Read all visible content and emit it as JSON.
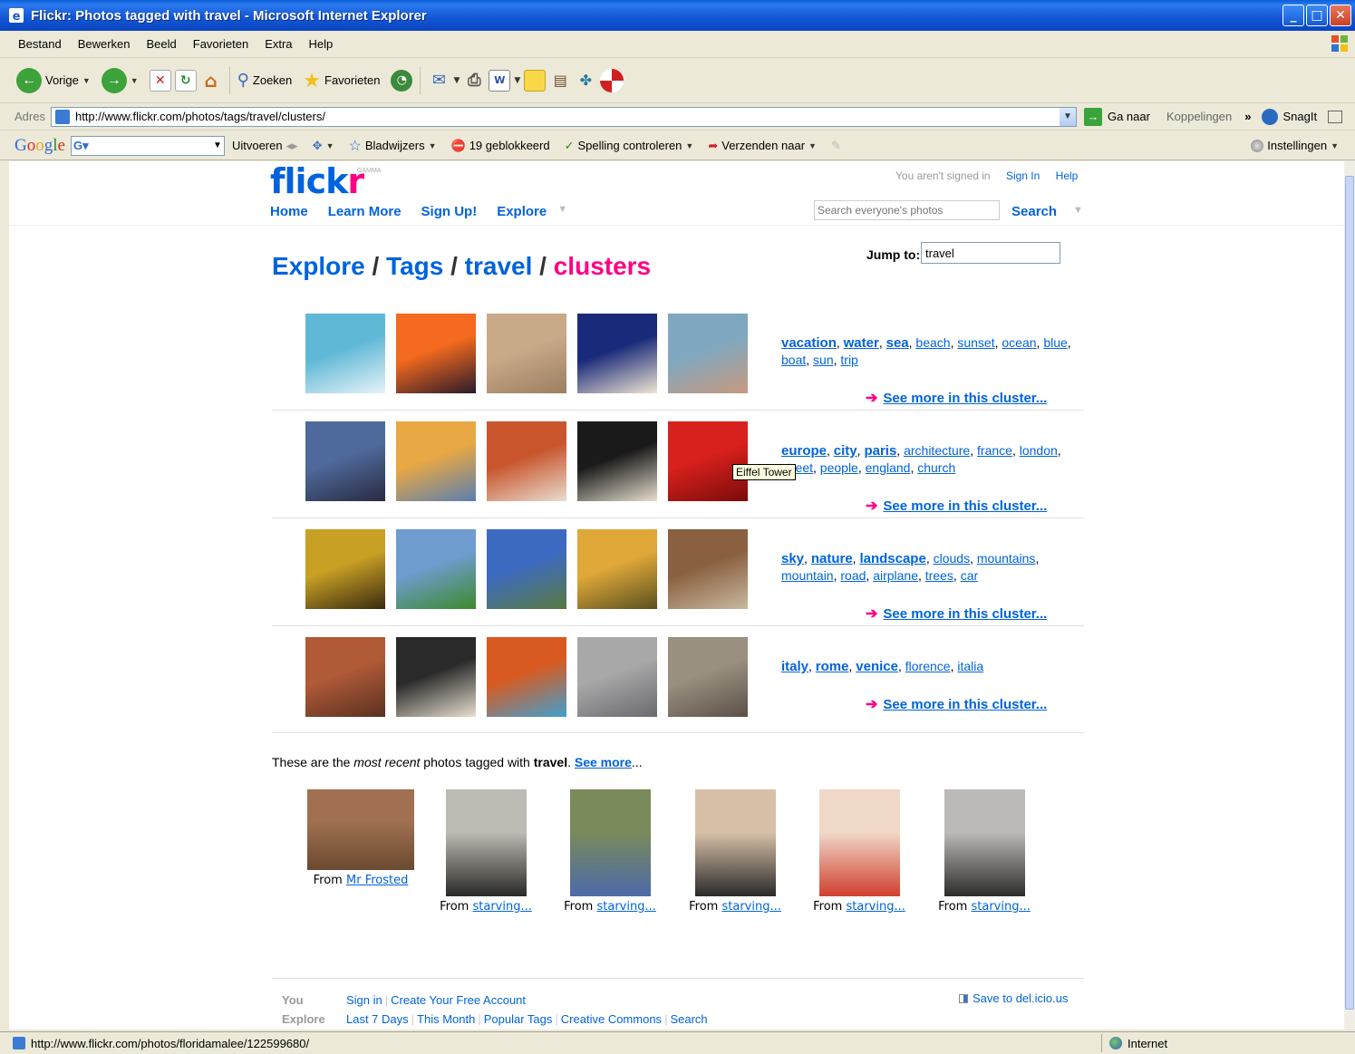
{
  "window": {
    "title": "Flickr: Photos tagged with travel - Microsoft Internet Explorer"
  },
  "menu": [
    "Bestand",
    "Bewerken",
    "Beeld",
    "Favorieten",
    "Extra",
    "Help"
  ],
  "toolbar": {
    "back": "Vorige",
    "search": "Zoeken",
    "favorites": "Favorieten"
  },
  "address": {
    "label": "Adres",
    "url": "http://www.flickr.com/photos/tags/travel/clusters/",
    "go": "Ga naar",
    "links": "Koppelingen",
    "snagit": "SnagIt"
  },
  "google": {
    "run": "Uitvoeren",
    "bookmarks": "Bladwijzers",
    "blocked": "19 geblokkeerd",
    "spell": "Spelling controleren",
    "send": "Verzenden naar",
    "settings": "Instellingen"
  },
  "flickr": {
    "logo_a": "flick",
    "logo_b": "r",
    "gamma": "GAMMA",
    "not_signed": "You aren't signed in",
    "sign_in": "Sign In",
    "help": "Help",
    "nav": [
      "Home",
      "Learn More",
      "Sign Up!",
      "Explore"
    ],
    "search_placeholder": "Search everyone's photos",
    "search_button": "Search",
    "crumbs": [
      "Explore",
      "Tags",
      "travel",
      "clusters"
    ],
    "jump_label": "Jump to:",
    "jump_value": "travel",
    "see_more_cluster": "See more in this cluster...",
    "tooltip": "Eiffel Tower",
    "clusters": [
      {
        "tags": [
          "vacation",
          "water",
          "sea",
          "beach",
          "sunset",
          "ocean",
          "blue",
          "boat",
          "sun",
          "trip"
        ],
        "big": 3,
        "thumbs": [
          [
            "#5FB8D6",
            "#E7F3F8"
          ],
          [
            "#F46A1E",
            "#2A1A2A"
          ],
          [
            "#C8A988",
            "#9C7E62"
          ],
          [
            "#1A2A7A",
            "#F0E6D2"
          ],
          [
            "#7FA8C0",
            "#C89A80"
          ]
        ]
      },
      {
        "tags": [
          "europe",
          "city",
          "paris",
          "architecture",
          "france",
          "london",
          "street",
          "people",
          "england",
          "church"
        ],
        "big": 3,
        "thumbs": [
          [
            "#4E6A9C",
            "#2A2A40"
          ],
          [
            "#E8A844",
            "#5A7EB0"
          ],
          [
            "#C8552C",
            "#E8DDD0"
          ],
          [
            "#1A1A1A",
            "#E8E0D0"
          ],
          [
            "#D8201C",
            "#7A0C0A"
          ]
        ]
      },
      {
        "tags": [
          "sky",
          "nature",
          "landscape",
          "clouds",
          "mountains",
          "mountain",
          "road",
          "airplane",
          "trees",
          "car"
        ],
        "big": 3,
        "thumbs": [
          [
            "#C8A024",
            "#3A2A10"
          ],
          [
            "#6F9CCF",
            "#3C8A2C"
          ],
          [
            "#3C6AC0",
            "#587A40"
          ],
          [
            "#E0A838",
            "#5A5020"
          ],
          [
            "#8A6040",
            "#C8B8A0"
          ]
        ]
      },
      {
        "tags": [
          "italy",
          "rome",
          "venice",
          "florence",
          "italia"
        ],
        "big": 3,
        "thumbs": [
          [
            "#B05A38",
            "#5A3020"
          ],
          [
            "#2A2A2A",
            "#E8E0D0"
          ],
          [
            "#D85A20",
            "#40A0D0"
          ],
          [
            "#A8A8A8",
            "#6A6A70"
          ],
          [
            "#9A9080",
            "#5A5048"
          ]
        ]
      }
    ],
    "recent_intro_a": "These are the ",
    "recent_intro_b": "most recent",
    "recent_intro_c": " photos tagged with ",
    "recent_tag": "travel",
    "recent_dot": ".",
    "recent_see_more": "See more",
    "recent_ellipsis": "...",
    "recent": [
      {
        "from": "From",
        "user": "Mr Frosted",
        "colors": [
          "#A07050",
          "#6A4A30"
        ]
      },
      {
        "from": "From",
        "user": "starving...",
        "colors": [
          "#BEBAB4",
          "#2A2A26"
        ]
      },
      {
        "from": "From",
        "user": "starving...",
        "colors": [
          "#7A8A5A",
          "#4C6AA8"
        ]
      },
      {
        "from": "From",
        "user": "starving...",
        "colors": [
          "#D8C0A8",
          "#2A2A2A"
        ]
      },
      {
        "from": "From",
        "user": "starving...",
        "colors": [
          "#F0D8C8",
          "#D04030"
        ]
      },
      {
        "from": "From",
        "user": "starving...",
        "colors": [
          "#BCBAB6",
          "#2C2C28"
        ]
      }
    ],
    "footer": {
      "you_label": "You",
      "you_links": [
        "Sign in",
        "Create Your Free Account"
      ],
      "explore_label": "Explore",
      "explore_links": [
        "Last 7 Days",
        "This Month",
        "Popular Tags",
        "Creative Commons",
        "Search"
      ],
      "delicious": "Save to del.icio.us"
    }
  },
  "status": {
    "url": "http://www.flickr.com/photos/floridamalee/122599680/",
    "zone": "Internet"
  }
}
